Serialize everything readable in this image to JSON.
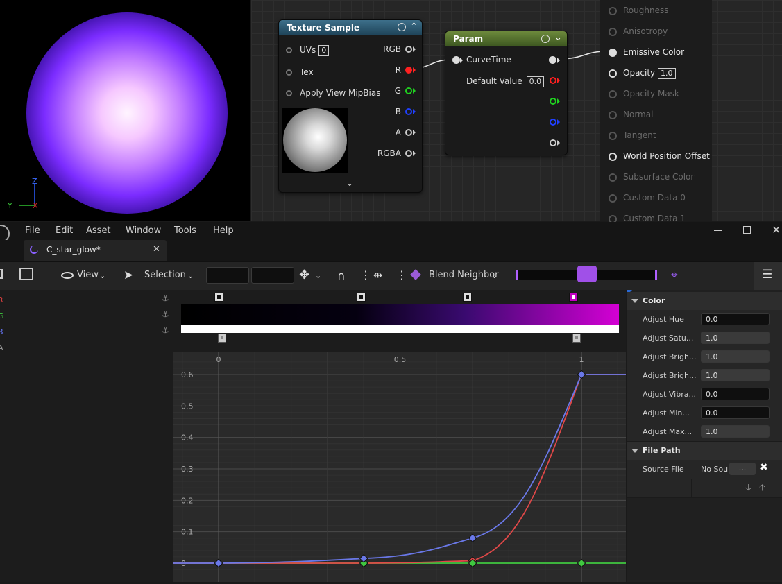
{
  "viewport": {
    "axis_z": "Z",
    "axis_y": "Y",
    "axis_x": "X"
  },
  "texture_node": {
    "title": "Texture Sample",
    "inputs": [
      {
        "label": "UVs",
        "value": "0"
      },
      {
        "label": "Tex"
      },
      {
        "label": "Apply View MipBias"
      }
    ],
    "outputs": [
      {
        "label": "RGB",
        "color": "#cccccc"
      },
      {
        "label": "R",
        "color": "#ff2020"
      },
      {
        "label": "G",
        "color": "#20d020"
      },
      {
        "label": "B",
        "color": "#2040ff"
      },
      {
        "label": "A",
        "color": "#cccccc"
      },
      {
        "label": "RGBA",
        "color": "#cccccc"
      }
    ]
  },
  "param_node": {
    "title": "Param",
    "input_label": "CurveTime",
    "default_label": "Default Value",
    "default_value": "0.0"
  },
  "result_node": {
    "items": [
      {
        "label": "Roughness",
        "active": false
      },
      {
        "label": "Anisotropy",
        "active": false
      },
      {
        "label": "Emissive Color",
        "active": true
      },
      {
        "label": "Opacity",
        "active": true,
        "value": "1.0"
      },
      {
        "label": "Opacity Mask",
        "active": false
      },
      {
        "label": "Normal",
        "active": false
      },
      {
        "label": "Tangent",
        "active": false
      },
      {
        "label": "World Position Offset",
        "active": true
      },
      {
        "label": "Subsurface Color",
        "active": false
      },
      {
        "label": "Custom Data 0",
        "active": false
      },
      {
        "label": "Custom Data 1",
        "active": false
      }
    ]
  },
  "menu": [
    "File",
    "Edit",
    "Asset",
    "Window",
    "Tools",
    "Help"
  ],
  "tab": {
    "title": "C_star_glow*"
  },
  "toolbar": {
    "view_label": "View",
    "selection_label": "Selection",
    "blend_label": "Blend Neighbor"
  },
  "channels": [
    {
      "label": "R",
      "color": "#e04040"
    },
    {
      "label": "G",
      "color": "#40d040"
    },
    {
      "label": "B",
      "color": "#6a7aff"
    },
    {
      "label": "A",
      "color": "#9a9a9a"
    }
  ],
  "gradient": {
    "stops": [
      {
        "pos": 0.0,
        "color": "#000000"
      },
      {
        "pos": 0.4,
        "color": "#050010"
      },
      {
        "pos": 0.65,
        "color": "#3a0a70"
      },
      {
        "pos": 1.0,
        "color": "#d400d4"
      }
    ],
    "top_keys": [
      0.0,
      0.4,
      0.65,
      1.0
    ],
    "bottom_keys": [
      0.0,
      1.0
    ]
  },
  "chart_data": {
    "type": "line",
    "x_ticks": [
      "0",
      "0.5",
      "1"
    ],
    "y_ticks": [
      "0",
      "0.1",
      "0.2",
      "0.3",
      "0.4",
      "0.5",
      "0.6"
    ],
    "xlim": [
      -0.12,
      1.12
    ],
    "ylim": [
      -0.05,
      0.65
    ],
    "grid": true,
    "series": [
      {
        "channel": "R",
        "color": "#e04848",
        "keys": [
          [
            0,
            0
          ],
          [
            0.4,
            0.0
          ],
          [
            0.7,
            0.008
          ],
          [
            1.0,
            0.6
          ]
        ]
      },
      {
        "channel": "G",
        "color": "#40c840",
        "keys": [
          [
            0,
            0
          ],
          [
            0.4,
            0
          ],
          [
            0.7,
            0
          ],
          [
            1.0,
            0
          ]
        ]
      },
      {
        "channel": "B",
        "color": "#6a78e8",
        "keys": [
          [
            0,
            0
          ],
          [
            0.4,
            0.015
          ],
          [
            0.7,
            0.08
          ],
          [
            1.0,
            0.6
          ]
        ]
      }
    ]
  },
  "details": {
    "section_color": "Color",
    "rows": [
      {
        "label": "Adjust Hue",
        "value": "0.0",
        "style": "dark"
      },
      {
        "label": "Adjust Satu...",
        "value": "1.0",
        "style": "gray"
      },
      {
        "label": "Adjust Brigh...",
        "value": "1.0",
        "style": "gray"
      },
      {
        "label": "Adjust Brigh...",
        "value": "1.0",
        "style": "gray"
      },
      {
        "label": "Adjust Vibra...",
        "value": "0.0",
        "style": "dark"
      },
      {
        "label": "Adjust Min...",
        "value": "0.0",
        "style": "dark"
      },
      {
        "label": "Adjust Max...",
        "value": "1.0",
        "style": "gray"
      }
    ],
    "section_file": "File Path",
    "source_label": "Source File",
    "source_value": "No Sour",
    "browse_label": "..."
  }
}
